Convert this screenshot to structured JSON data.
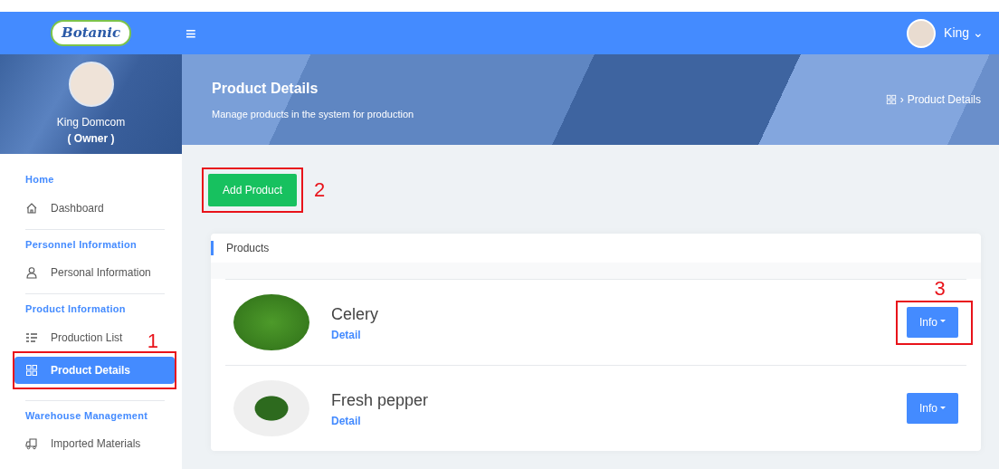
{
  "navbar": {
    "logo": "Botanic",
    "menu_glyph": "≡",
    "user_name": "King",
    "caret": "⌄"
  },
  "profile": {
    "name": "King Domcom",
    "role": "( Owner )"
  },
  "sidebar": [
    {
      "title": "Home",
      "items": [
        {
          "label": "Dashboard",
          "selected": false
        }
      ]
    },
    {
      "title": "Personnel Information",
      "items": [
        {
          "label": "Personal Information",
          "selected": false
        }
      ]
    },
    {
      "title": "Product Information",
      "items": [
        {
          "label": "Production List",
          "selected": false
        },
        {
          "label": "Product Details",
          "selected": true,
          "callout": "1"
        }
      ]
    },
    {
      "title": "Warehouse Management",
      "items": [
        {
          "label": "Imported Materials",
          "selected": false
        }
      ]
    }
  ],
  "header": {
    "title": "Product Details",
    "subtitle": "Manage products in the system for production",
    "breadcrumb_separator": "›",
    "breadcrumb": "Product Details"
  },
  "add_button": {
    "label": "Add Product",
    "callout": "2"
  },
  "card": {
    "title": "Products",
    "products": [
      {
        "name": "Celery",
        "link": "Detail",
        "button": "Info",
        "callout": "3"
      },
      {
        "name": "Fresh pepper",
        "link": "Detail",
        "button": "Info"
      }
    ]
  }
}
